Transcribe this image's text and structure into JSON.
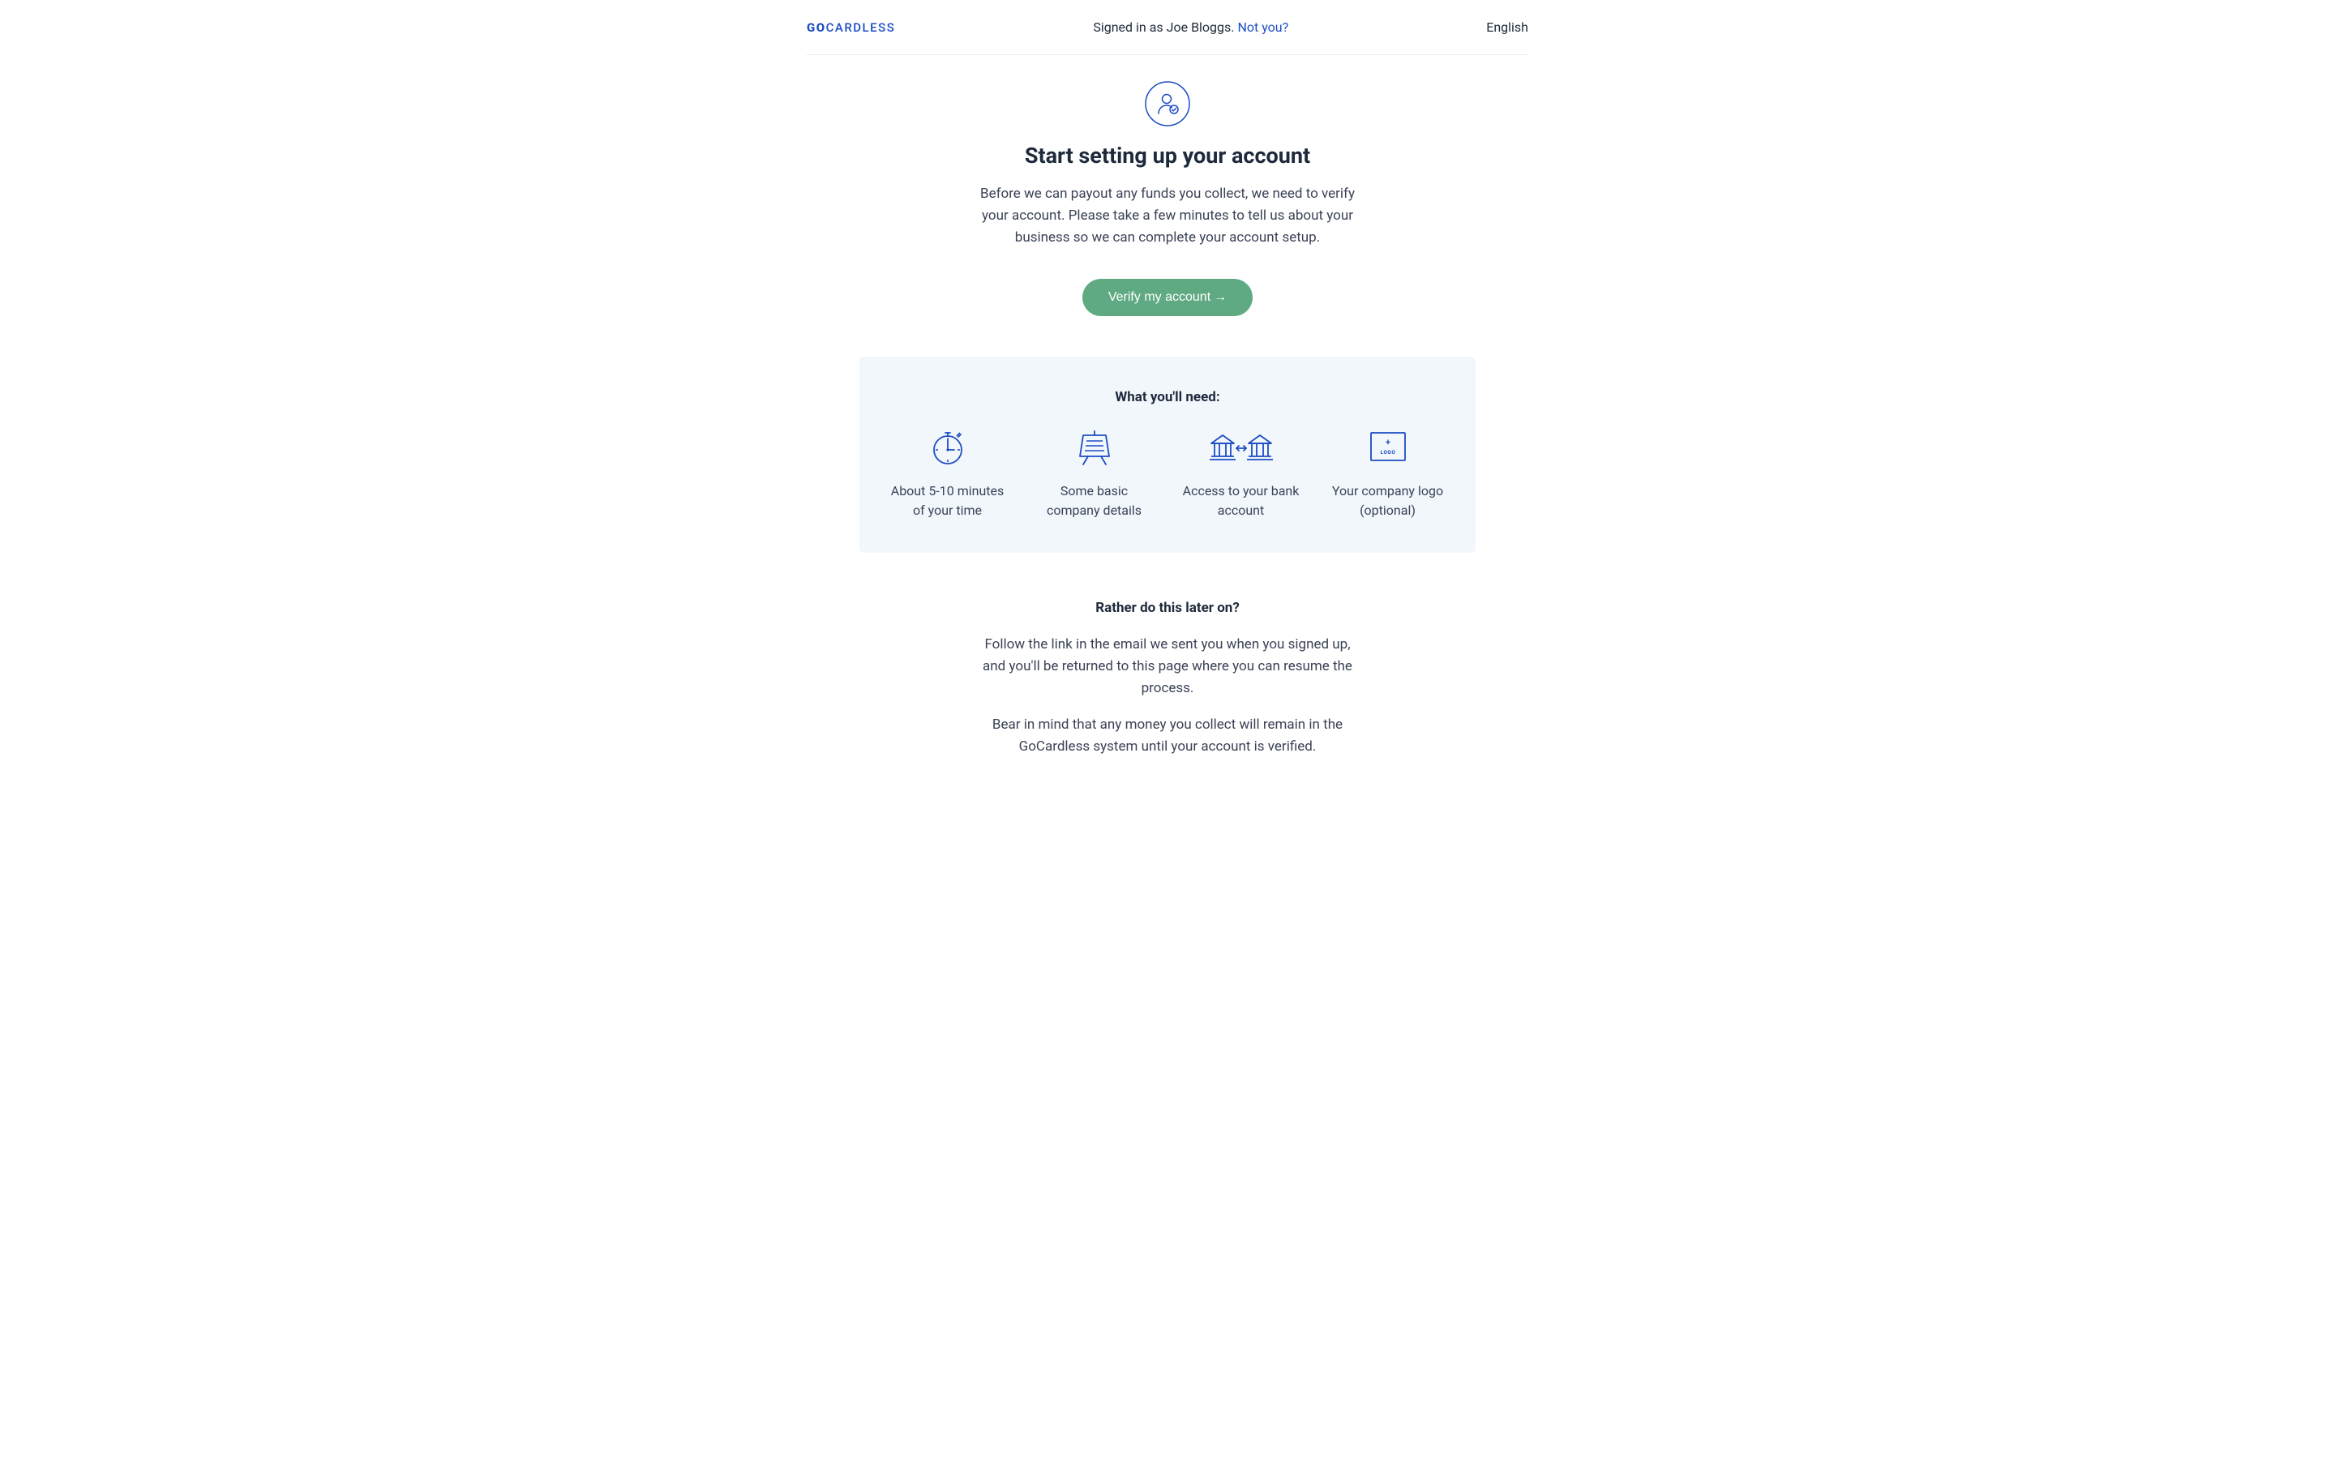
{
  "header": {
    "logo_bold": "GO",
    "logo_rest": "CARDLESS",
    "signed_in_prefix": "Signed in as ",
    "user_name": "Joe Bloggs",
    "signed_in_suffix": ". ",
    "not_you": "Not you?",
    "language": "English"
  },
  "hero": {
    "title": "Start setting up your account",
    "body": "Before we can payout any funds you collect, we need to verify your account. Please take a few minutes to tell us about your business so we can complete your account setup.",
    "cta": "Verify my account",
    "cta_arrow": "→"
  },
  "panel": {
    "heading": "What you'll need:",
    "items": [
      {
        "label": "About 5-10 minutes of your time"
      },
      {
        "label": "Some basic company details"
      },
      {
        "label": "Access to your bank account"
      },
      {
        "label": "Your company logo (optional)"
      }
    ]
  },
  "later": {
    "heading": "Rather do this later on?",
    "p1": "Follow the link in the email we sent you when you signed up, and you'll be returned to this page where you can resume the process.",
    "p2": "Bear in mind that any money you collect will remain in the GoCardless system until your account is verified."
  },
  "colors": {
    "primary_blue": "#1c4cc3",
    "cta_green": "#5faa82",
    "panel_bg": "#f2f7fc",
    "text_dark": "#1e2a3b",
    "text_body": "#3a4256"
  }
}
